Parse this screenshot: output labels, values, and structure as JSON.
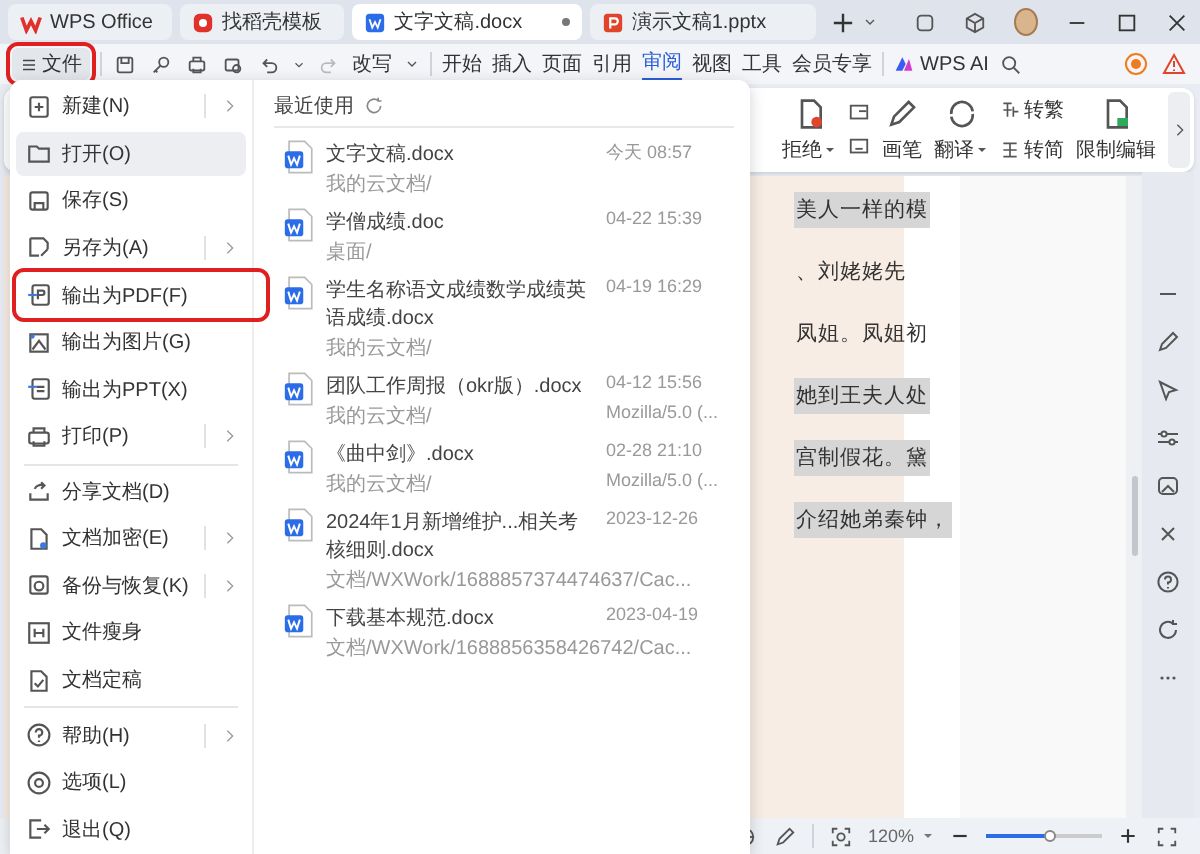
{
  "tabs": [
    {
      "label": "WPS Office",
      "kind": "wps",
      "selected": false,
      "closable": false
    },
    {
      "label": "找稻壳模板",
      "kind": "docer",
      "selected": false,
      "closable": false
    },
    {
      "label": "文字文稿.docx",
      "kind": "writer",
      "selected": true,
      "closable": true
    },
    {
      "label": "演示文稿1.pptx",
      "kind": "presentation",
      "selected": false,
      "closable": false
    }
  ],
  "menu_bar": {
    "file_button": {
      "label": "文件",
      "annotated": true
    },
    "mode": "改写",
    "tabs": [
      {
        "label": "开始",
        "selected": false
      },
      {
        "label": "插入",
        "selected": false
      },
      {
        "label": "页面",
        "selected": false
      },
      {
        "label": "引用",
        "selected": false
      },
      {
        "label": "审阅",
        "selected": true
      },
      {
        "label": "视图",
        "selected": false
      },
      {
        "label": "工具",
        "selected": false
      },
      {
        "label": "会员专享",
        "selected": false
      }
    ],
    "ai_button": "WPS AI"
  },
  "ribbon": {
    "items": [
      {
        "label": "拒绝",
        "kind": "reject"
      },
      {
        "label": "画笔",
        "kind": "pen"
      },
      {
        "label": "翻译",
        "kind": "translate"
      },
      {
        "label": "转繁",
        "kind": "to-traditional"
      },
      {
        "label": "转简",
        "kind": "to-simplified"
      },
      {
        "label": "限制编辑",
        "kind": "restrict"
      }
    ]
  },
  "document": {
    "lines": [
      {
        "text": "美人一样的模",
        "highlighted": true
      },
      {
        "text": "、刘姥姥先",
        "highlighted": false
      },
      {
        "text": "凤姐。凤姐初",
        "highlighted": false
      },
      {
        "text": "她到王夫人处",
        "highlighted": true
      },
      {
        "text": "宫制假花。黛",
        "highlighted": true
      },
      {
        "text": "介绍她弟秦钟，",
        "highlighted": true
      }
    ]
  },
  "status_bar": {
    "zoom": "120%",
    "zoom_slider": {
      "level": 0.55
    }
  },
  "file_menu": {
    "items": [
      {
        "label": "新建(N)",
        "kind": "new",
        "submenu": true,
        "selected": false,
        "annotated": false,
        "divider_after": false
      },
      {
        "label": "打开(O)",
        "kind": "open",
        "submenu": false,
        "selected": true,
        "annotated": false,
        "divider_after": false
      },
      {
        "label": "保存(S)",
        "kind": "save",
        "submenu": false,
        "selected": false,
        "annotated": false,
        "divider_after": false
      },
      {
        "label": "另存为(A)",
        "kind": "save-as",
        "submenu": true,
        "selected": false,
        "annotated": false,
        "divider_after": false
      },
      {
        "label": "输出为PDF(F)",
        "kind": "pdf",
        "submenu": false,
        "selected": false,
        "annotated": true,
        "divider_after": false
      },
      {
        "label": "输出为图片(G)",
        "kind": "image",
        "submenu": false,
        "selected": false,
        "annotated": false,
        "divider_after": false
      },
      {
        "label": "输出为PPT(X)",
        "kind": "ppt",
        "submenu": false,
        "selected": false,
        "annotated": false,
        "divider_after": false
      },
      {
        "label": "打印(P)",
        "kind": "print",
        "submenu": true,
        "selected": false,
        "annotated": false,
        "divider_after": true
      },
      {
        "label": "分享文档(D)",
        "kind": "share",
        "submenu": false,
        "selected": false,
        "annotated": false,
        "divider_after": false
      },
      {
        "label": "文档加密(E)",
        "kind": "encrypt",
        "submenu": true,
        "selected": false,
        "annotated": false,
        "divider_after": false
      },
      {
        "label": "备份与恢复(K)",
        "kind": "backup",
        "submenu": true,
        "selected": false,
        "annotated": false,
        "divider_after": false
      },
      {
        "label": "文件瘦身",
        "kind": "slim",
        "submenu": false,
        "selected": false,
        "annotated": false,
        "divider_after": false
      },
      {
        "label": "文档定稿",
        "kind": "finalize",
        "submenu": false,
        "selected": false,
        "annotated": false,
        "divider_after": true
      },
      {
        "label": "帮助(H)",
        "kind": "help",
        "submenu": true,
        "selected": false,
        "annotated": false,
        "divider_after": false
      },
      {
        "label": "选项(L)",
        "kind": "options",
        "submenu": false,
        "selected": false,
        "annotated": false,
        "divider_after": false
      },
      {
        "label": "退出(Q)",
        "kind": "exit",
        "submenu": false,
        "selected": false,
        "annotated": false,
        "divider_after": false
      }
    ],
    "recent": {
      "title": "最近使用",
      "files": [
        {
          "name": "文字文稿.docx",
          "path": "我的云文档/",
          "time": "今天 08:57"
        },
        {
          "name": "学僧成绩.doc",
          "path": "桌面/",
          "time": "04-22 15:39"
        },
        {
          "name": "学生名称语文成绩数学成绩英语成绩.docx",
          "path": "我的云文档/",
          "time": "04-19 16:29"
        },
        {
          "name": "团队工作周报（okr版）.docx",
          "path": "我的云文档/",
          "time": "04-12 15:56",
          "source": "Mozilla/5.0 (..."
        },
        {
          "name": "《曲中剑》.docx",
          "path": "我的云文档/",
          "time": "02-28 21:10",
          "source": "Mozilla/5.0 (..."
        },
        {
          "name": "2024年1月新增维护...相关考核细则.docx",
          "path": "文档/WXWork/1688857374474637/Cac...",
          "time": "2023-12-26"
        },
        {
          "name": "下载基本规范.docx",
          "path": "文档/WXWork/1688856358426742/Cac...",
          "time": "2023-04-19"
        }
      ]
    }
  }
}
